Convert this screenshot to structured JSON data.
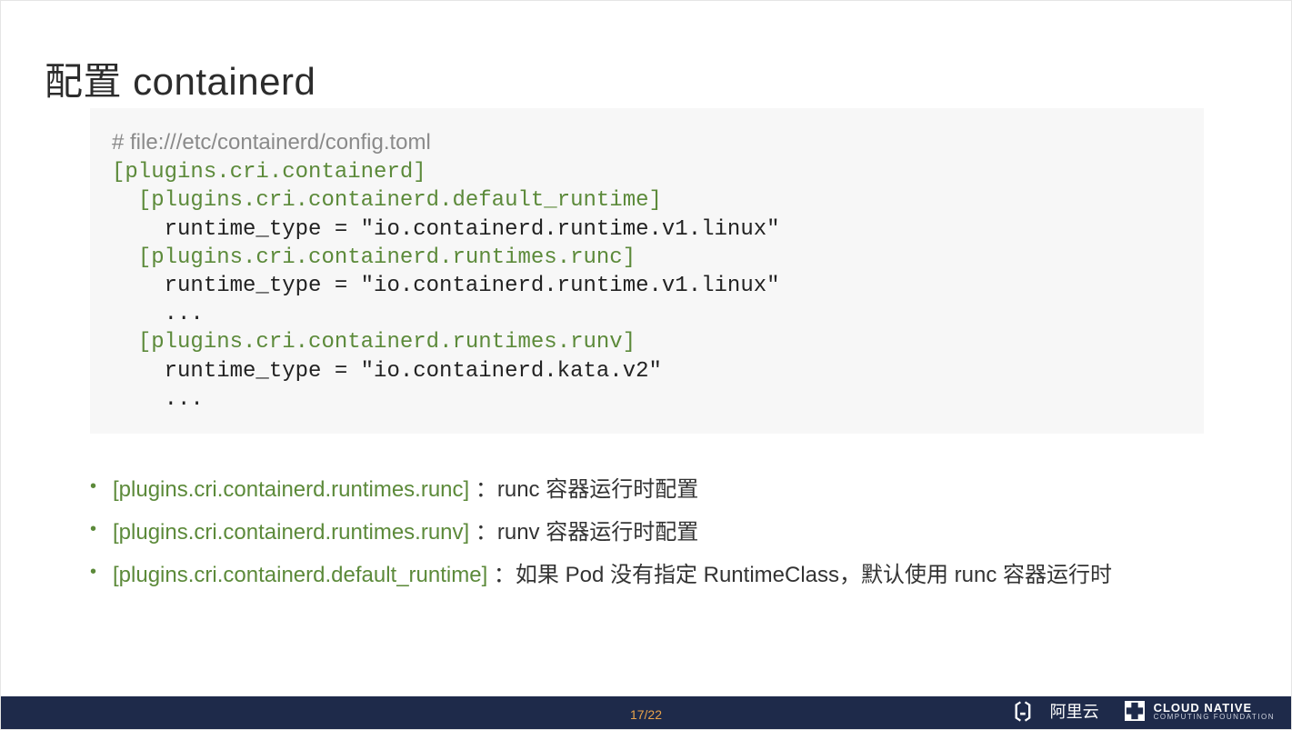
{
  "title": "配置 containerd",
  "code": {
    "comment": "# file:///etc/containerd/config.toml",
    "l1": "[plugins.cri.containerd]",
    "l2": "[plugins.cri.containerd.default_runtime]",
    "l3": "runtime_type = \"io.containerd.runtime.v1.linux\"",
    "l4": "[plugins.cri.containerd.runtimes.runc]",
    "l5": "runtime_type = \"io.containerd.runtime.v1.linux\"",
    "l6": "...",
    "l7": "[plugins.cri.containerd.runtimes.runv]",
    "l8": "runtime_type = \"io.containerd.kata.v2\"",
    "l9": "..."
  },
  "bullets": {
    "b1key": "[plugins.cri.containerd.runtimes.runc]",
    "b1txt": " ：runc 容器运行时配置",
    "b2key": "[plugins.cri.containerd.runtimes.runv]",
    "b2txt": " ：runv 容器运行时配置",
    "b3key": "[plugins.cri.containerd.default_runtime]",
    "b3txt": " ：如果 Pod 没有指定 RuntimeClass，默认使用 runc 容器运行时"
  },
  "footer": {
    "page": "17/22",
    "ali_brand": "阿里云",
    "cncf_top": "CLOUD NATIVE",
    "cncf_bot": "COMPUTING FOUNDATION"
  }
}
